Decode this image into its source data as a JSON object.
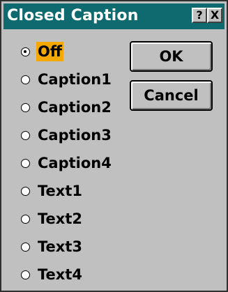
{
  "window": {
    "title": "Closed Caption",
    "help_label": "?",
    "close_label": "X"
  },
  "options": [
    {
      "label": "Off",
      "selected": true
    },
    {
      "label": "Caption1",
      "selected": false
    },
    {
      "label": "Caption2",
      "selected": false
    },
    {
      "label": "Caption3",
      "selected": false
    },
    {
      "label": "Caption4",
      "selected": false
    },
    {
      "label": "Text1",
      "selected": false
    },
    {
      "label": "Text2",
      "selected": false
    },
    {
      "label": "Text3",
      "selected": false
    },
    {
      "label": "Text4",
      "selected": false
    }
  ],
  "buttons": {
    "ok_label": "OK",
    "cancel_label": "Cancel"
  },
  "colors": {
    "titlebar": "#0f6a6f",
    "highlight": "#f5a800",
    "window_bg": "#c0c0c0"
  }
}
